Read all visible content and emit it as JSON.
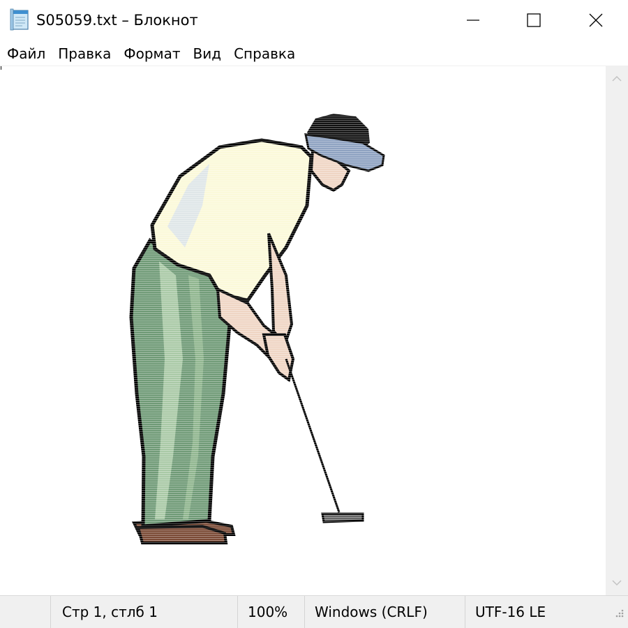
{
  "window": {
    "title": "S05059.txt – Блокнот",
    "app_icon": "notepad-icon",
    "controls": [
      "minimize-icon",
      "maximize-icon",
      "close-icon"
    ]
  },
  "menu": {
    "items": [
      "Файл",
      "Правка",
      "Формат",
      "Вид",
      "Справка"
    ]
  },
  "editor": {
    "content_description_icon": "golfer-putting-ascii-art",
    "colors": {
      "shirt": "#fbf9d9",
      "pants": "#6f9a76",
      "pants_highlight": "#a9c9a6",
      "skin": "#efd5c4",
      "cap": "#8ea2c1",
      "hair": "#111111",
      "shoes": "#7a4a35",
      "outline": "#000000"
    }
  },
  "statusbar": {
    "position": "Стр 1, стлб 1",
    "zoom": "100%",
    "line_endings": "Windows (CRLF)",
    "encoding": "UTF-16 LE"
  },
  "scrollbar": {
    "up_icon": "chevron-up-icon",
    "down_icon": "chevron-down-icon"
  }
}
